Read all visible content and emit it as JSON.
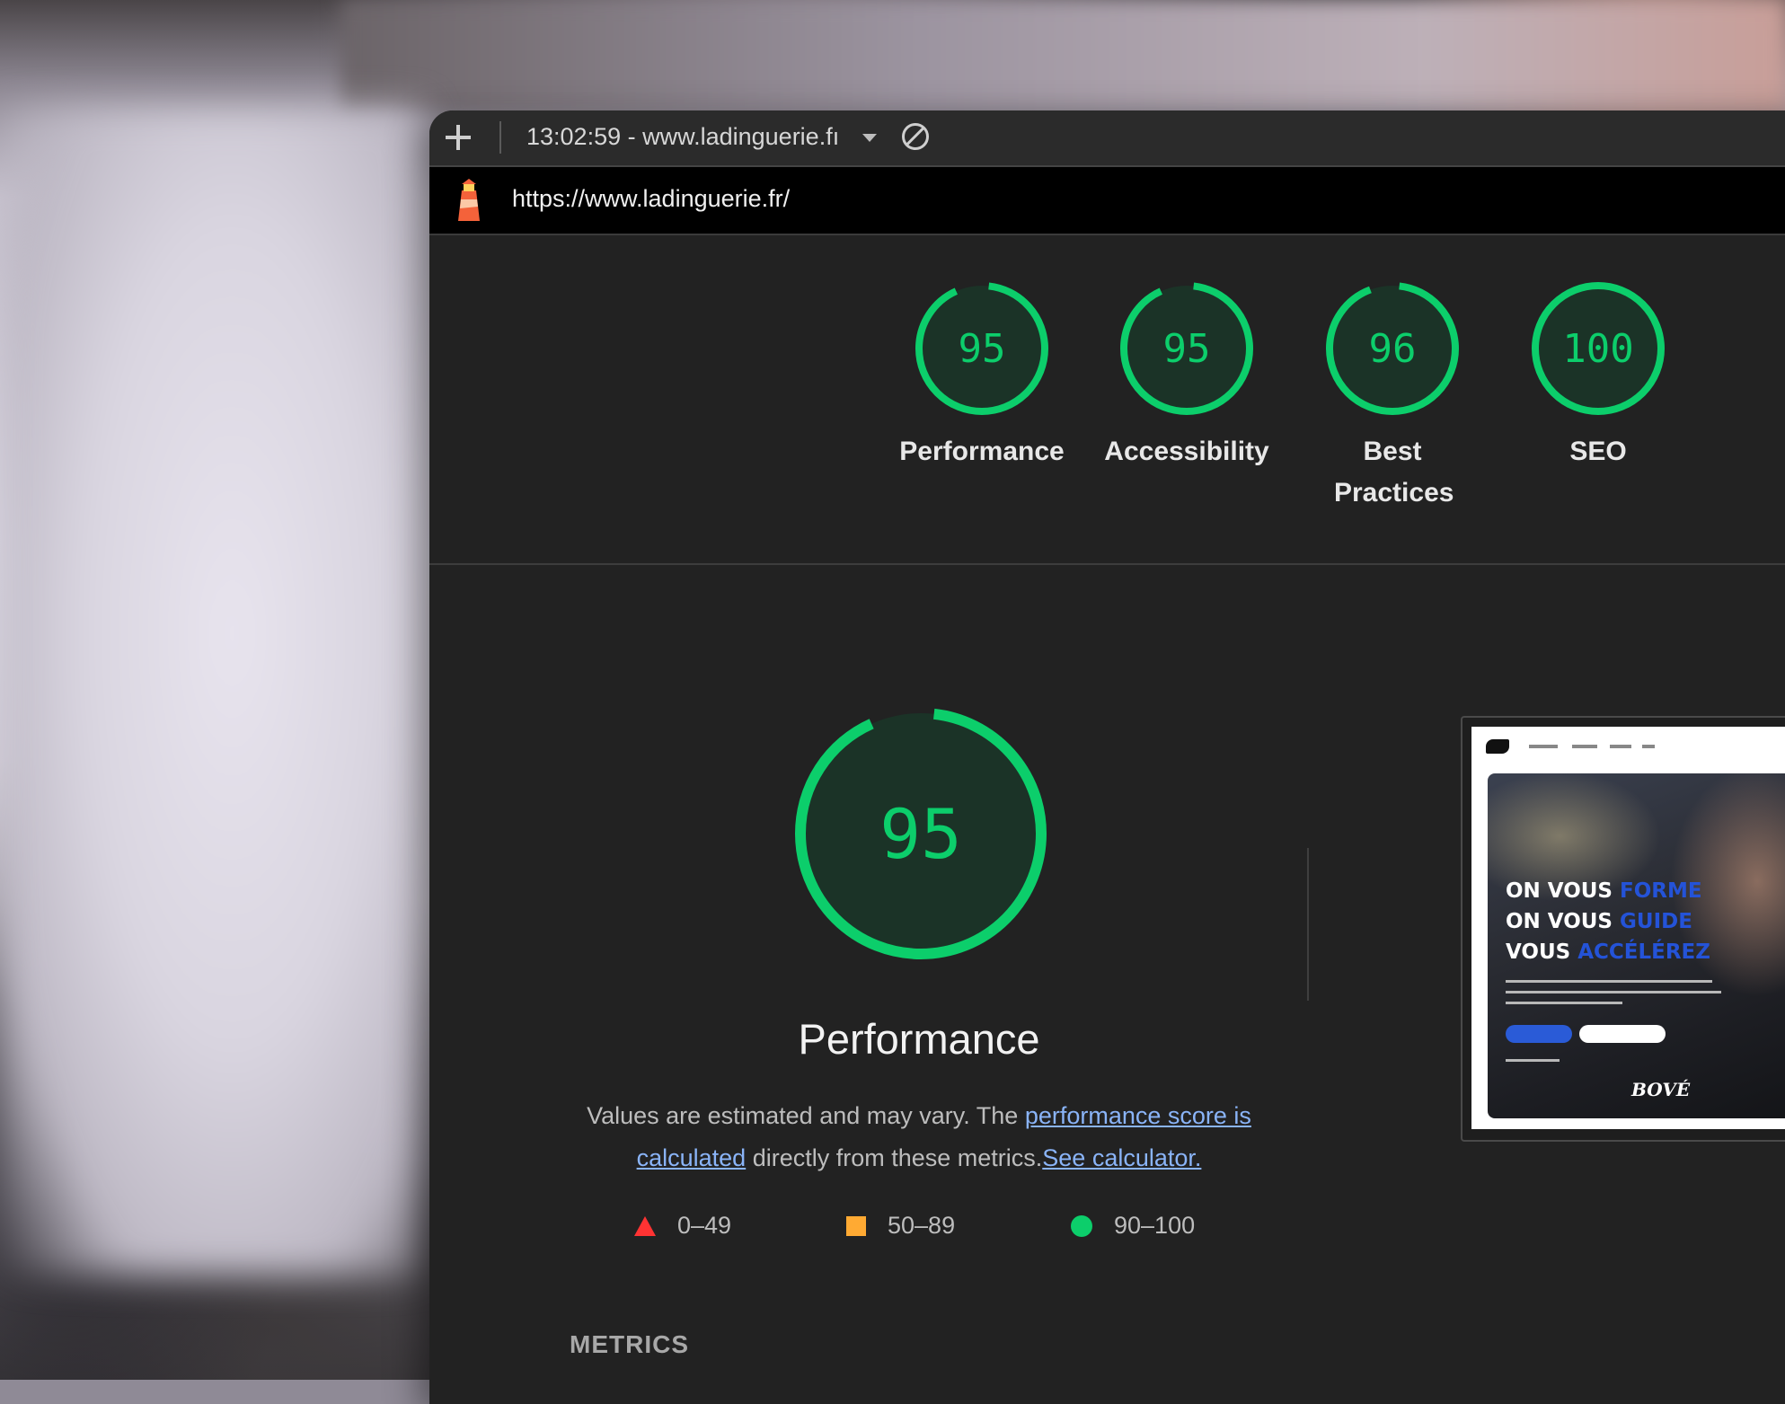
{
  "toolbar": {
    "report_label": "13:02:59 - www.ladinguerie.fı"
  },
  "urlbar": {
    "url": "https://www.ladinguerie.fr/"
  },
  "scores": [
    {
      "label": "Performance",
      "value": 95
    },
    {
      "label": "Accessibility",
      "value": 95
    },
    {
      "label": "Best Practices",
      "value": 96
    },
    {
      "label": "SEO",
      "value": 100
    }
  ],
  "performance": {
    "value": 95,
    "title": "Performance",
    "desc_prefix": "Values are estimated and may vary. The ",
    "desc_link1": "performance score is calculated",
    "desc_middle": " directly from these metrics.",
    "desc_link2": "See calculator."
  },
  "legend": [
    {
      "range": "0–49",
      "color": "#ff3333"
    },
    {
      "range": "50–89",
      "color": "#ffaa33"
    },
    {
      "range": "90–100",
      "color": "#0cce6b"
    }
  ],
  "metrics_label": "METRICS",
  "thumbnail": {
    "line1_white": "ON VOUS ",
    "line1_blue": "FORME",
    "line2_white": "ON VOUS ",
    "line2_blue": "GUIDE",
    "line3_white": "VOUS ",
    "line3_blue": "ACCÉLÉREZ",
    "brand": "BOVÉ"
  },
  "colors": {
    "pass": "#0cce6b",
    "pass_bg": "#1b3327",
    "link": "#8ab4f8"
  }
}
